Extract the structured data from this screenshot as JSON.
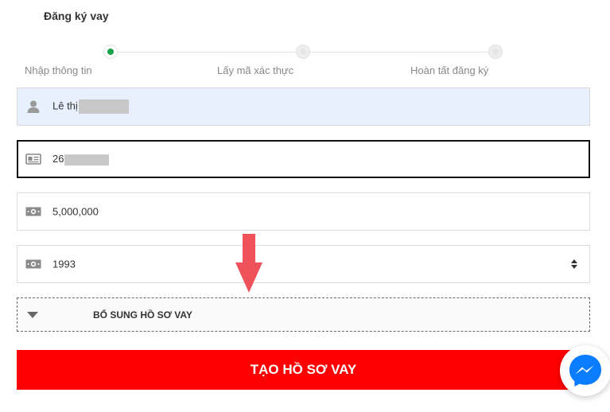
{
  "form": {
    "title": "Đăng ký vay"
  },
  "steps": [
    {
      "label": "Nhập thông tin",
      "state": "active"
    },
    {
      "label": "Lấy mã xác thực",
      "state": "pending"
    },
    {
      "label": "Hoàn tất đăng ký",
      "state": "pending"
    }
  ],
  "fields": {
    "name": {
      "value": "Lê thị",
      "icon": "user-icon",
      "redacted": true
    },
    "id_number": {
      "value": "26",
      "icon": "id-card-icon",
      "redacted": true
    },
    "amount": {
      "value": "5,000,000",
      "icon": "money-icon"
    },
    "birth_year": {
      "value": "1993",
      "icon": "money-icon"
    }
  },
  "collapse": {
    "label": "BỔ SUNG HỒ SƠ VAY"
  },
  "submit": {
    "label": "TẠO HỒ SƠ VAY"
  },
  "colors": {
    "accent": "#ff0000",
    "step_active": "#1aa34a",
    "highlight_bg": "#e8f0fe",
    "arrow": "#f0525c",
    "messenger": "#0a7cff"
  }
}
